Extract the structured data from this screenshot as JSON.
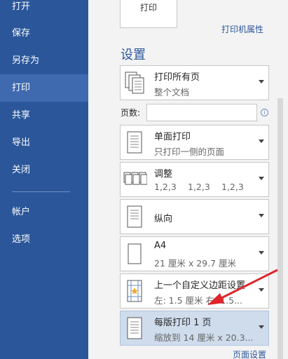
{
  "sidebar": {
    "items": [
      {
        "label": "打开"
      },
      {
        "label": "保存"
      },
      {
        "label": "另存为"
      },
      {
        "label": "打印"
      },
      {
        "label": "共享"
      },
      {
        "label": "导出"
      },
      {
        "label": "关闭"
      },
      {
        "label": "帐户"
      },
      {
        "label": "选项"
      }
    ],
    "active_index": 3
  },
  "print_button": {
    "label": "打印"
  },
  "printer_properties_link": "打印机属性",
  "settings": {
    "title": "设置",
    "pages_label": "页数:",
    "pages_value": "",
    "print_range": {
      "title": "打印所有页",
      "sub": "整个文档"
    },
    "sides": {
      "title": "单面打印",
      "sub": "只打印一侧的页面"
    },
    "collate": {
      "title": "调整",
      "sub": [
        "1,2,3",
        "1,2,3",
        "1,2,3"
      ]
    },
    "orientation": {
      "title": "纵向"
    },
    "paper": {
      "title": "A4",
      "sub": "21 厘米 x 29.7 厘米"
    },
    "margins": {
      "title": "上一个自定义边距设置",
      "sub": "左: 1.5 厘米   右: 1.5..."
    },
    "pages_per_sheet": {
      "title": "每版打印 1 页",
      "sub": "缩放到 14 厘米 x 20.3..."
    }
  },
  "page_setup_link": "页面设置",
  "colors": {
    "sidebar": "#2b579a",
    "sidebar_active": "#3f6ab0",
    "accent": "#2b579a",
    "arrow": "#e0242a"
  }
}
